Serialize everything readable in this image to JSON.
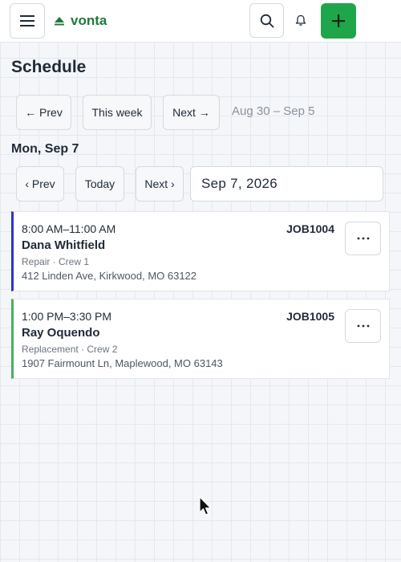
{
  "app": {
    "logo_text": "vonta",
    "brand_color": "#1f7a3a",
    "add_button_color": "#1fa64a"
  },
  "header": {
    "icons": {
      "menu": "hamburger-menu-icon",
      "search": "search-icon",
      "notifications": "bell-icon",
      "add": "plus-icon"
    }
  },
  "page": {
    "title": "Schedule"
  },
  "week_nav": {
    "prev_label": "← Prev",
    "this_week_label": "This week",
    "next_label": "Next →",
    "range_text": "Aug 30 – Sep 5"
  },
  "day": {
    "heading": "Mon, Sep 7",
    "prev_label": "‹ Prev",
    "today_label": "Today",
    "next_label": "Next ›",
    "date_value": "Sep 7, 2026"
  },
  "jobs": [
    {
      "time": "8:00 AM–11:00 AM",
      "id": "JOB1004",
      "name": "Dana Whitfield",
      "meta": "Repair · Crew 1",
      "address": "412 Linden Ave, Kirkwood, MO 63122",
      "accent": "#2a35c9",
      "more_label": "···"
    },
    {
      "time": "1:00 PM–3:30 PM",
      "id": "JOB1005",
      "name": "Ray Oquendo",
      "meta": "Replacement · Crew 2",
      "address": "1907 Fairmount Ln, Maplewood, MO 63143",
      "accent": "#4caf63",
      "more_label": "···"
    }
  ]
}
